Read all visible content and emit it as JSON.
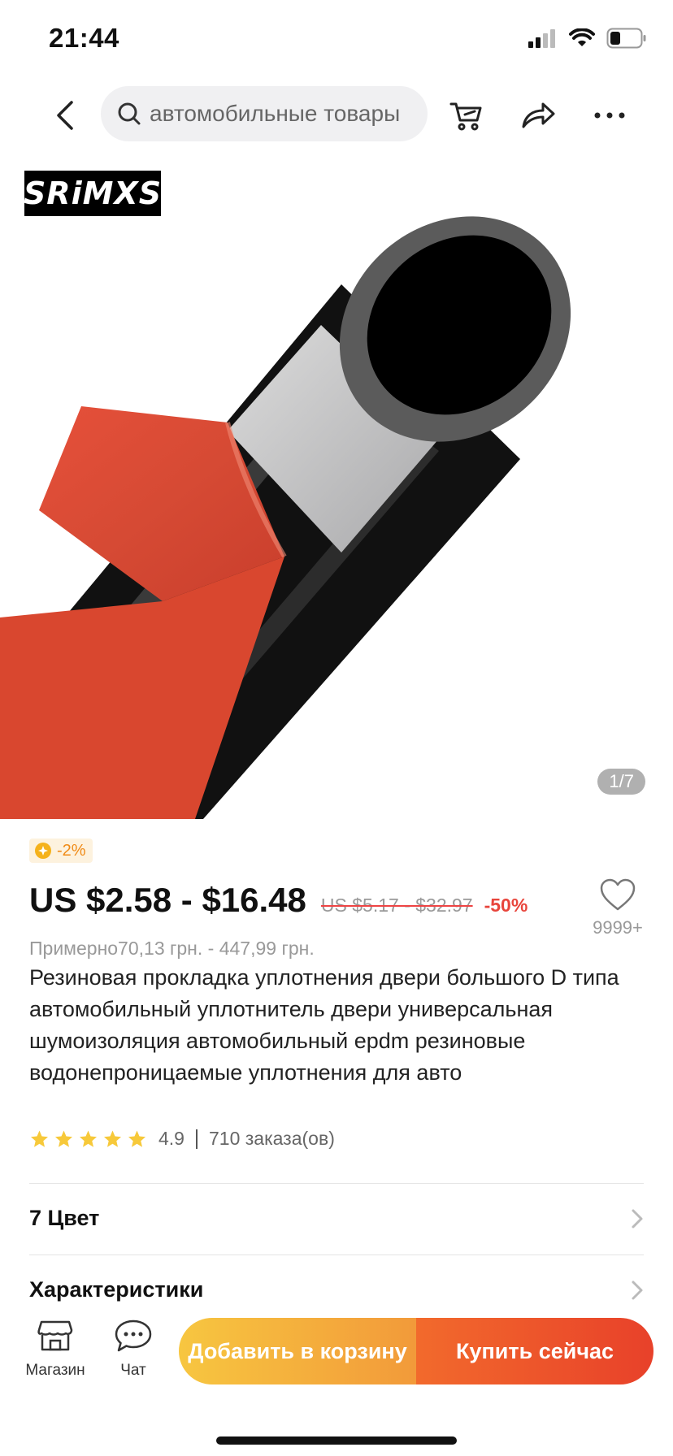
{
  "status_bar": {
    "time": "21:44"
  },
  "nav": {
    "search_text": "автомобильные товары",
    "icons": [
      "back-icon",
      "search-icon",
      "cart-icon",
      "share-icon",
      "more-icon"
    ]
  },
  "gallery": {
    "brand_logo": "SRiMXS",
    "counter": "1/7"
  },
  "product": {
    "discount_badge": "-2%",
    "price": "US $2.58 - $16.48",
    "old_price": "US $5.17 - $32.97",
    "discount_percent": "-50%",
    "wishlist_count": "9999+",
    "approx_price": "Примерно70,13 грн. - 447,99 грн.",
    "title": "Резиновая прокладка уплотнения двери большого D типа автомобильный уплотнитель двери универсальная шумоизоляция автомобильный epdm резиновые водонепроницаемые уплотнения для авто",
    "rating": "4.9",
    "rating_stars": 5,
    "orders": "710 заказа(ов)"
  },
  "options": [
    {
      "label": "7 Цвет"
    },
    {
      "label": "Характеристики"
    }
  ],
  "bottom_bar": {
    "store_label": "Магазин",
    "chat_label": "Чат",
    "add_to_cart_label": "Добавить в корзину",
    "buy_now_label": "Купить сейчас"
  },
  "colors": {
    "accent_red": "#e8412a",
    "accent_orange": "#f29a3a",
    "accent_yellow": "#f7c640",
    "star": "#f7c93a",
    "search_bg": "#f0f0f2"
  }
}
